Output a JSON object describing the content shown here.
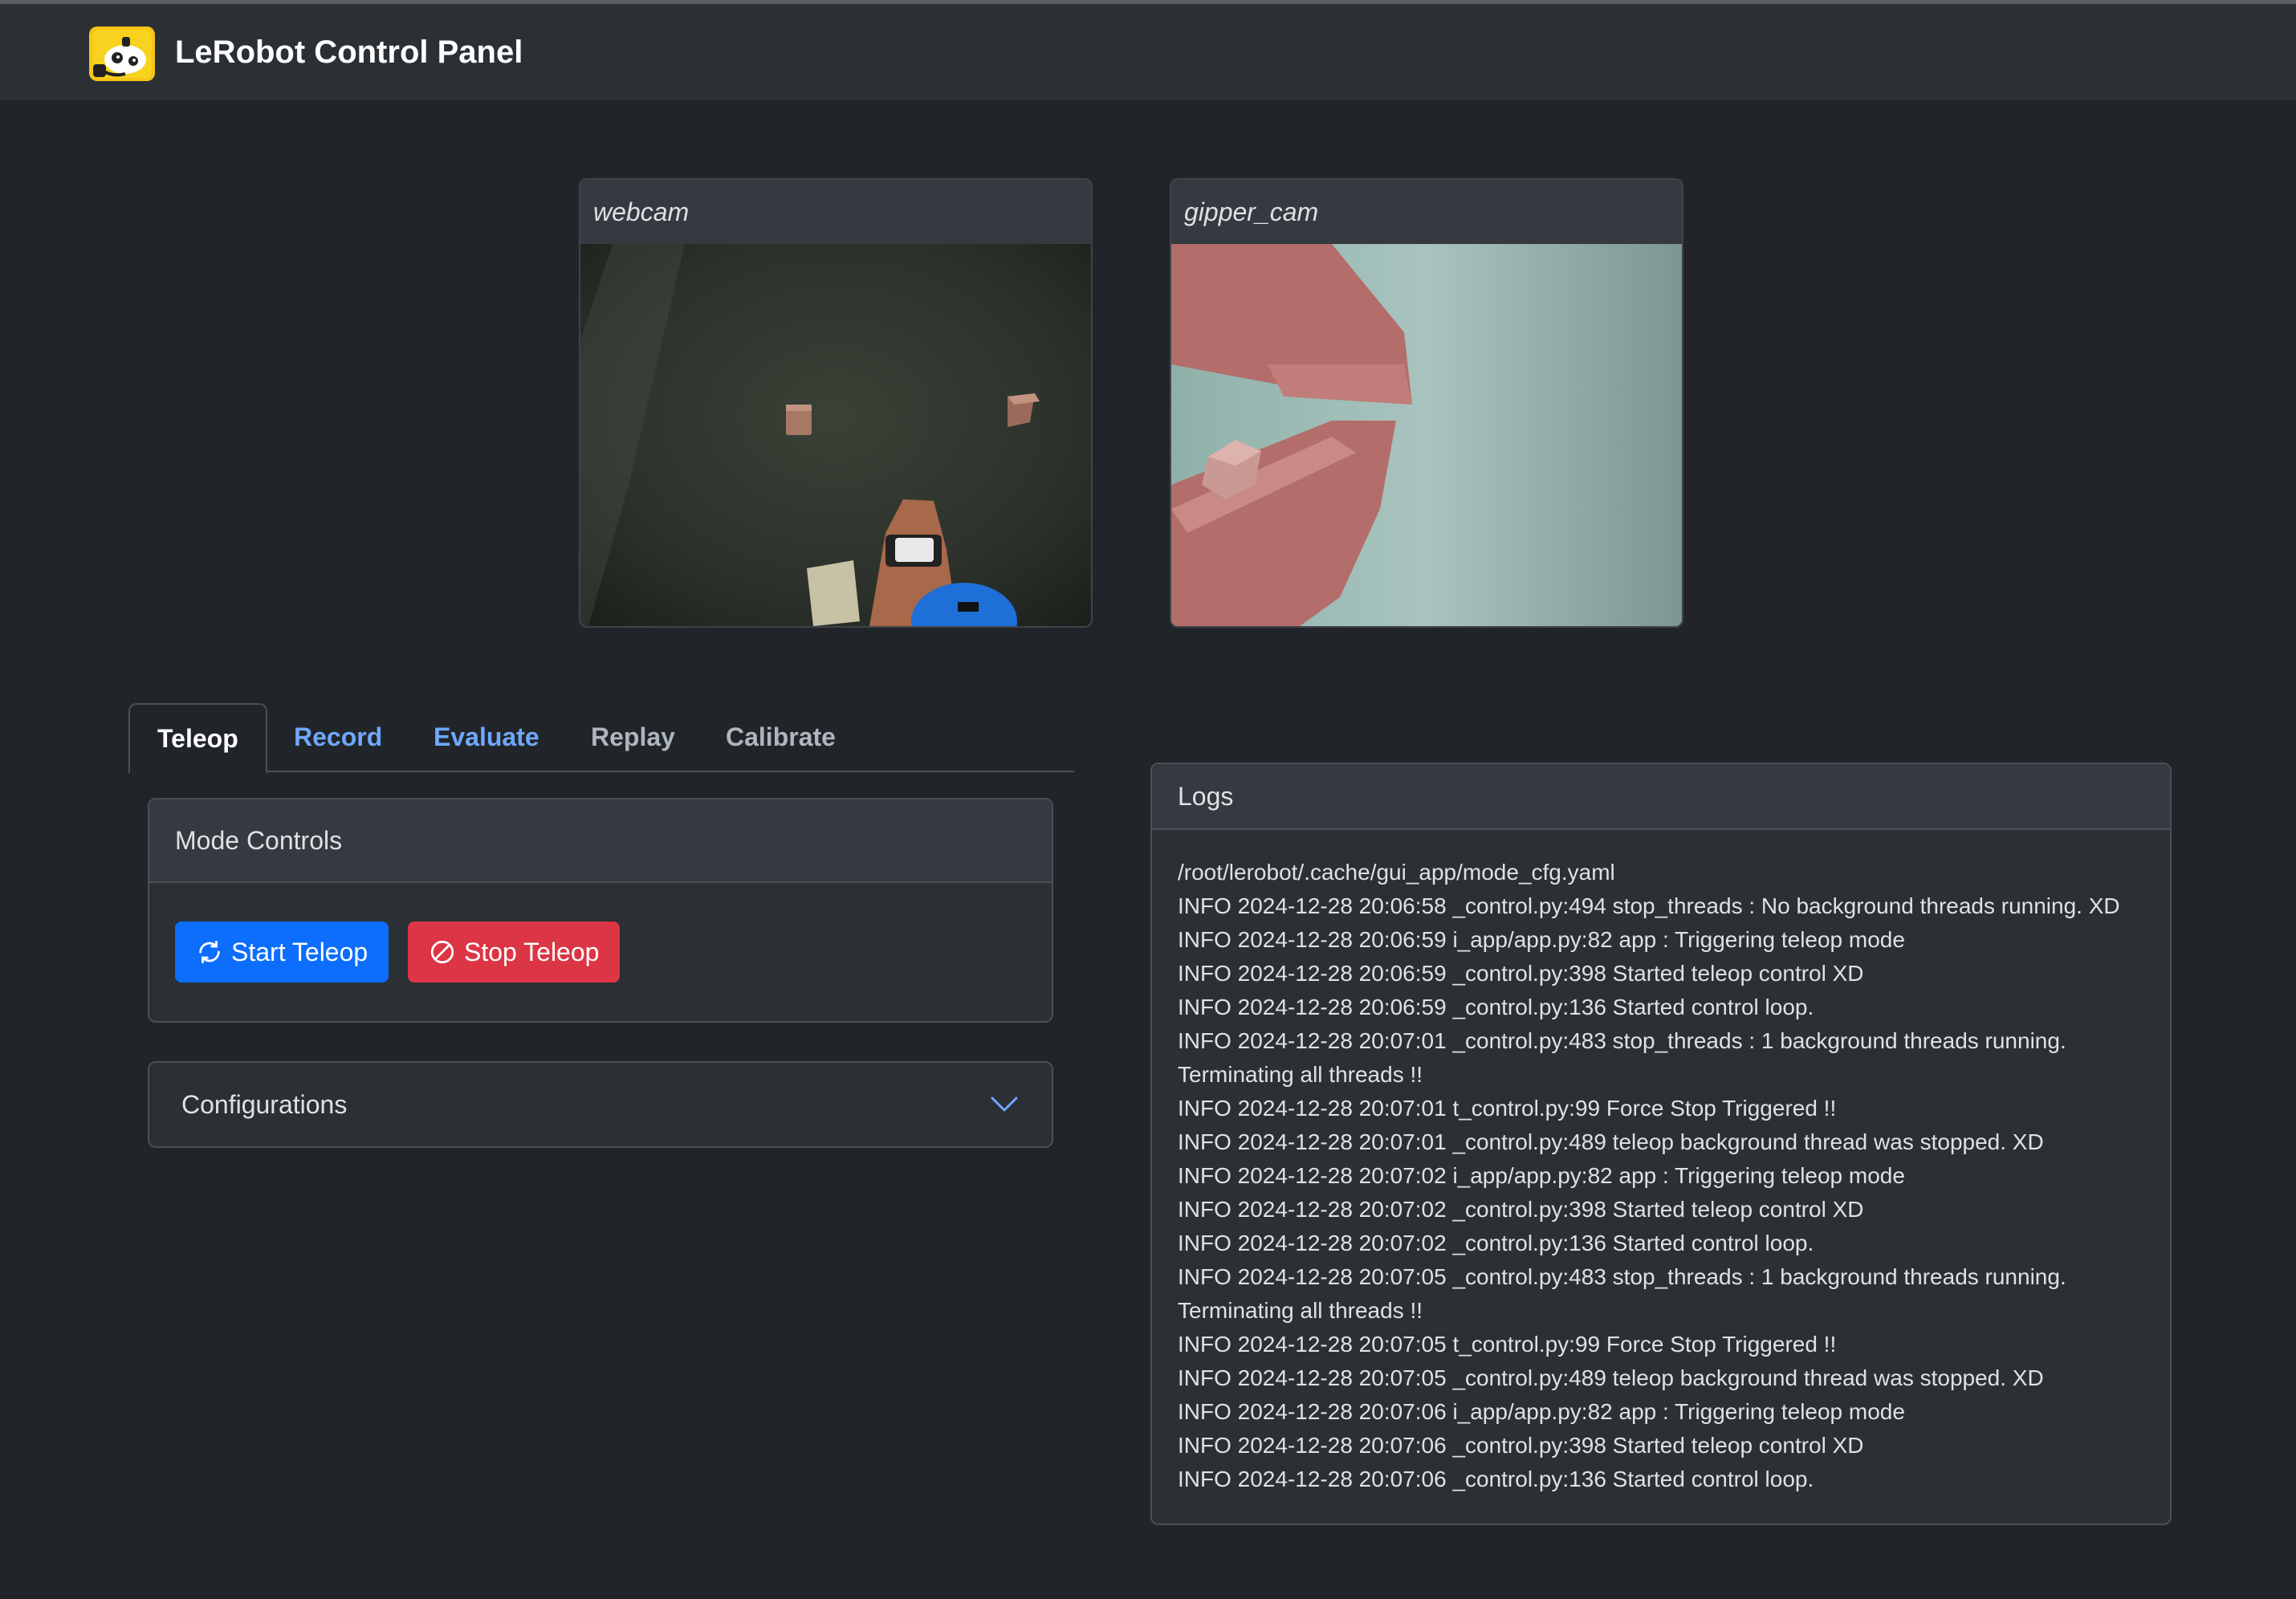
{
  "app": {
    "title": "LeRobot Control Panel",
    "logo_icon": "robot-logo-icon"
  },
  "cameras": [
    {
      "name": "webcam"
    },
    {
      "name": "gipper_cam"
    }
  ],
  "tabs": [
    {
      "label": "Teleop",
      "active": true
    },
    {
      "label": "Record"
    },
    {
      "label": "Evaluate"
    },
    {
      "label": "Replay"
    },
    {
      "label": "Calibrate"
    }
  ],
  "mode_controls": {
    "title": "Mode Controls",
    "start_label": "Start Teleop",
    "stop_label": "Stop Teleop"
  },
  "configurations": {
    "title": "Configurations"
  },
  "logs": {
    "title": "Logs",
    "lines": [
      "/root/lerobot/.cache/gui_app/mode_cfg.yaml",
      "INFO 2024-12-28 20:06:58 _control.py:494 stop_threads : No background threads running. XD",
      "INFO 2024-12-28 20:06:59 i_app/app.py:82 app : Triggering teleop mode",
      "INFO 2024-12-28 20:06:59 _control.py:398 Started teleop control XD",
      "INFO 2024-12-28 20:06:59 _control.py:136 Started control loop.",
      "INFO 2024-12-28 20:07:01 _control.py:483 stop_threads : 1 background threads running.",
      "Terminating all threads !!",
      "INFO 2024-12-28 20:07:01 t_control.py:99 Force Stop Triggered !!",
      "INFO 2024-12-28 20:07:01 _control.py:489 teleop background thread was stopped. XD",
      "INFO 2024-12-28 20:07:02 i_app/app.py:82 app : Triggering teleop mode",
      "INFO 2024-12-28 20:07:02 _control.py:398 Started teleop control XD",
      "INFO 2024-12-28 20:07:02 _control.py:136 Started control loop.",
      "INFO 2024-12-28 20:07:05 _control.py:483 stop_threads : 1 background threads running.",
      "Terminating all threads !!",
      "INFO 2024-12-28 20:07:05 t_control.py:99 Force Stop Triggered !!",
      "INFO 2024-12-28 20:07:05 _control.py:489 teleop background thread was stopped. XD",
      "INFO 2024-12-28 20:07:06 i_app/app.py:82 app : Triggering teleop mode",
      "INFO 2024-12-28 20:07:06 _control.py:398 Started teleop control XD",
      "INFO 2024-12-28 20:07:06 _control.py:136 Started control loop."
    ]
  },
  "colors": {
    "background": "#212529",
    "navbar": "#2b3035",
    "primary": "#0d6efd",
    "danger": "#dc3545",
    "tab_link": "#6ea8fe"
  }
}
